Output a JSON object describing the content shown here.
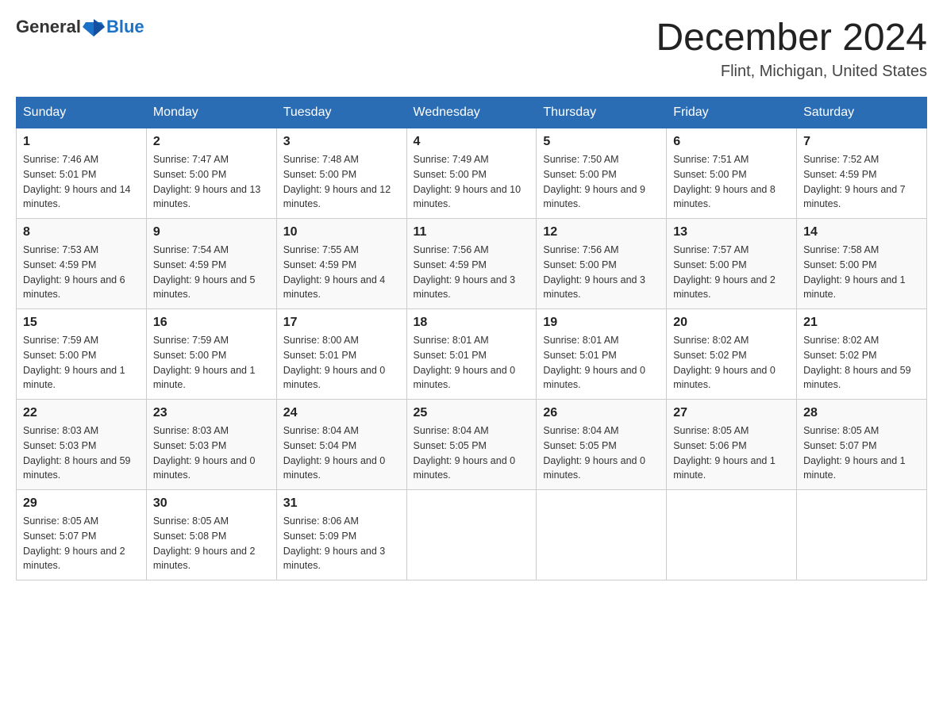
{
  "header": {
    "logo_general": "General",
    "logo_blue": "Blue",
    "title": "December 2024",
    "subtitle": "Flint, Michigan, United States"
  },
  "days_of_week": [
    "Sunday",
    "Monday",
    "Tuesday",
    "Wednesday",
    "Thursday",
    "Friday",
    "Saturday"
  ],
  "weeks": [
    [
      {
        "day": "1",
        "sunrise": "7:46 AM",
        "sunset": "5:01 PM",
        "daylight": "9 hours and 14 minutes."
      },
      {
        "day": "2",
        "sunrise": "7:47 AM",
        "sunset": "5:00 PM",
        "daylight": "9 hours and 13 minutes."
      },
      {
        "day": "3",
        "sunrise": "7:48 AM",
        "sunset": "5:00 PM",
        "daylight": "9 hours and 12 minutes."
      },
      {
        "day": "4",
        "sunrise": "7:49 AM",
        "sunset": "5:00 PM",
        "daylight": "9 hours and 10 minutes."
      },
      {
        "day": "5",
        "sunrise": "7:50 AM",
        "sunset": "5:00 PM",
        "daylight": "9 hours and 9 minutes."
      },
      {
        "day": "6",
        "sunrise": "7:51 AM",
        "sunset": "5:00 PM",
        "daylight": "9 hours and 8 minutes."
      },
      {
        "day": "7",
        "sunrise": "7:52 AM",
        "sunset": "4:59 PM",
        "daylight": "9 hours and 7 minutes."
      }
    ],
    [
      {
        "day": "8",
        "sunrise": "7:53 AM",
        "sunset": "4:59 PM",
        "daylight": "9 hours and 6 minutes."
      },
      {
        "day": "9",
        "sunrise": "7:54 AM",
        "sunset": "4:59 PM",
        "daylight": "9 hours and 5 minutes."
      },
      {
        "day": "10",
        "sunrise": "7:55 AM",
        "sunset": "4:59 PM",
        "daylight": "9 hours and 4 minutes."
      },
      {
        "day": "11",
        "sunrise": "7:56 AM",
        "sunset": "4:59 PM",
        "daylight": "9 hours and 3 minutes."
      },
      {
        "day": "12",
        "sunrise": "7:56 AM",
        "sunset": "5:00 PM",
        "daylight": "9 hours and 3 minutes."
      },
      {
        "day": "13",
        "sunrise": "7:57 AM",
        "sunset": "5:00 PM",
        "daylight": "9 hours and 2 minutes."
      },
      {
        "day": "14",
        "sunrise": "7:58 AM",
        "sunset": "5:00 PM",
        "daylight": "9 hours and 1 minute."
      }
    ],
    [
      {
        "day": "15",
        "sunrise": "7:59 AM",
        "sunset": "5:00 PM",
        "daylight": "9 hours and 1 minute."
      },
      {
        "day": "16",
        "sunrise": "7:59 AM",
        "sunset": "5:00 PM",
        "daylight": "9 hours and 1 minute."
      },
      {
        "day": "17",
        "sunrise": "8:00 AM",
        "sunset": "5:01 PM",
        "daylight": "9 hours and 0 minutes."
      },
      {
        "day": "18",
        "sunrise": "8:01 AM",
        "sunset": "5:01 PM",
        "daylight": "9 hours and 0 minutes."
      },
      {
        "day": "19",
        "sunrise": "8:01 AM",
        "sunset": "5:01 PM",
        "daylight": "9 hours and 0 minutes."
      },
      {
        "day": "20",
        "sunrise": "8:02 AM",
        "sunset": "5:02 PM",
        "daylight": "9 hours and 0 minutes."
      },
      {
        "day": "21",
        "sunrise": "8:02 AM",
        "sunset": "5:02 PM",
        "daylight": "8 hours and 59 minutes."
      }
    ],
    [
      {
        "day": "22",
        "sunrise": "8:03 AM",
        "sunset": "5:03 PM",
        "daylight": "8 hours and 59 minutes."
      },
      {
        "day": "23",
        "sunrise": "8:03 AM",
        "sunset": "5:03 PM",
        "daylight": "9 hours and 0 minutes."
      },
      {
        "day": "24",
        "sunrise": "8:04 AM",
        "sunset": "5:04 PM",
        "daylight": "9 hours and 0 minutes."
      },
      {
        "day": "25",
        "sunrise": "8:04 AM",
        "sunset": "5:05 PM",
        "daylight": "9 hours and 0 minutes."
      },
      {
        "day": "26",
        "sunrise": "8:04 AM",
        "sunset": "5:05 PM",
        "daylight": "9 hours and 0 minutes."
      },
      {
        "day": "27",
        "sunrise": "8:05 AM",
        "sunset": "5:06 PM",
        "daylight": "9 hours and 1 minute."
      },
      {
        "day": "28",
        "sunrise": "8:05 AM",
        "sunset": "5:07 PM",
        "daylight": "9 hours and 1 minute."
      }
    ],
    [
      {
        "day": "29",
        "sunrise": "8:05 AM",
        "sunset": "5:07 PM",
        "daylight": "9 hours and 2 minutes."
      },
      {
        "day": "30",
        "sunrise": "8:05 AM",
        "sunset": "5:08 PM",
        "daylight": "9 hours and 2 minutes."
      },
      {
        "day": "31",
        "sunrise": "8:06 AM",
        "sunset": "5:09 PM",
        "daylight": "9 hours and 3 minutes."
      },
      null,
      null,
      null,
      null
    ]
  ]
}
